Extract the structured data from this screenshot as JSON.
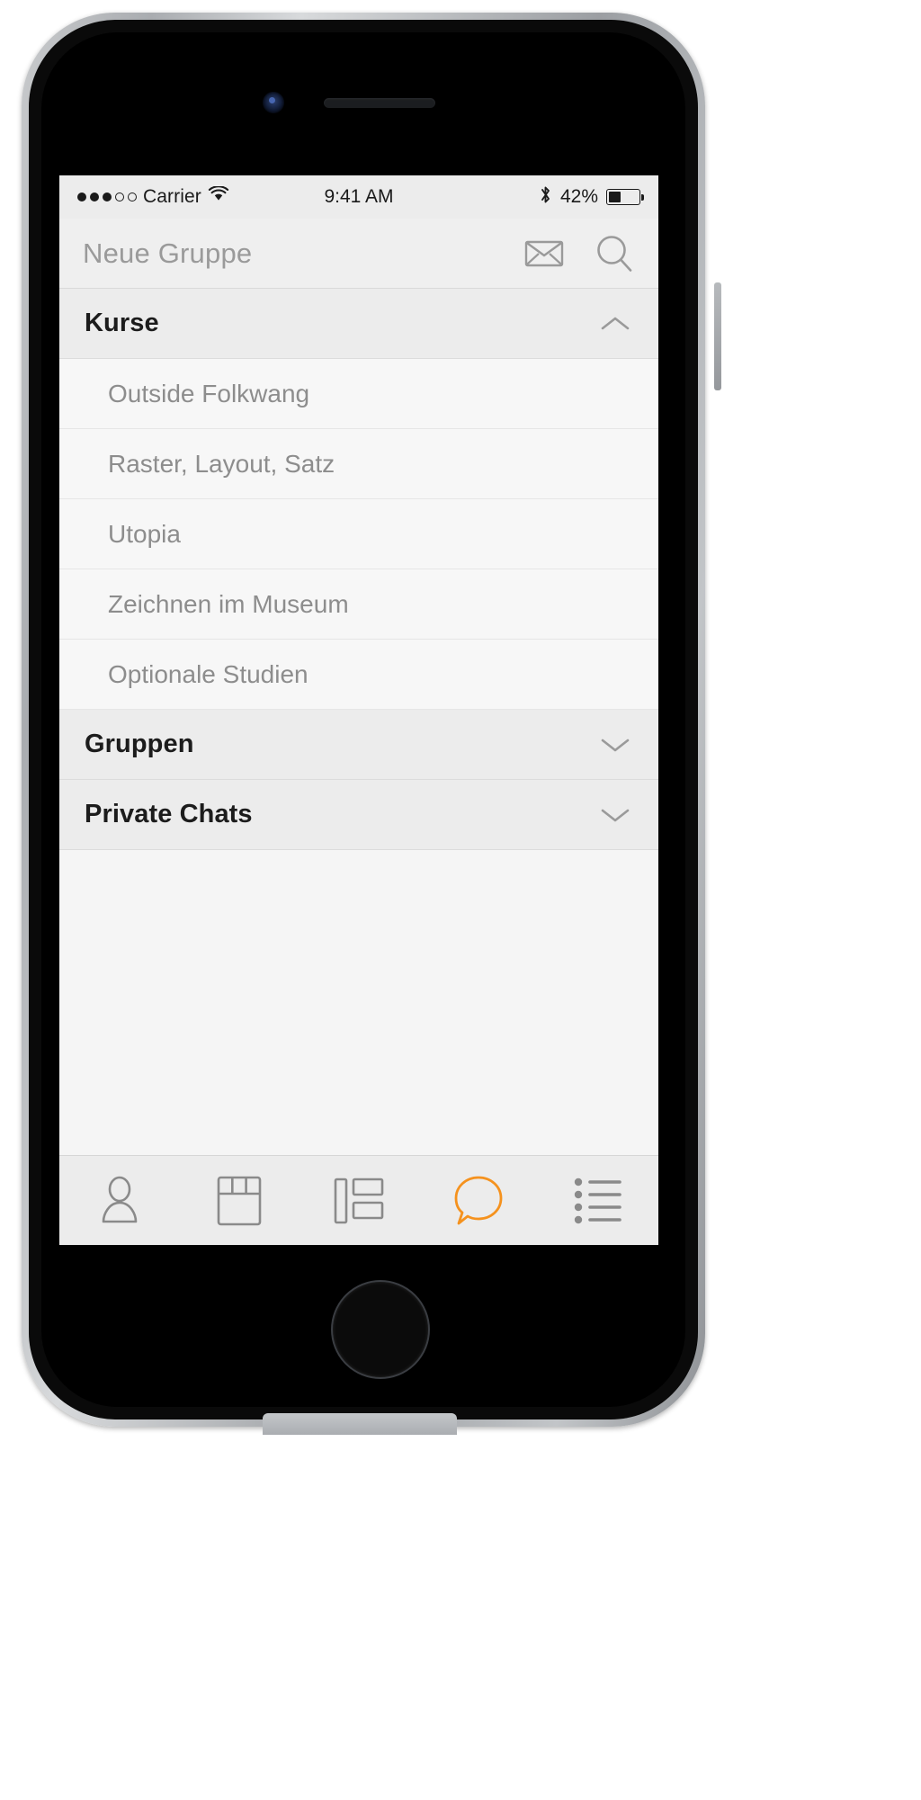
{
  "device": {
    "name": "iphone-mockup",
    "frame_color": "#b1b4b8"
  },
  "status_bar": {
    "signal_dots_filled": 3,
    "signal_dots_total": 5,
    "carrier": "Carrier",
    "wifi_icon": "wifi-icon",
    "time": "9:41 AM",
    "bluetooth_icon": "bluetooth-icon",
    "battery_percent_label": "42%",
    "battery_level": 42
  },
  "navbar": {
    "title": "Neue Gruppe",
    "actions": [
      {
        "icon": "envelope-icon",
        "name": "compose-message-button"
      },
      {
        "icon": "search-icon",
        "name": "search-button"
      }
    ]
  },
  "sections": [
    {
      "id": "kurse",
      "label": "Kurse",
      "expanded": true,
      "chevron": "chevron-up-icon",
      "items": [
        {
          "label": "Outside Folkwang"
        },
        {
          "label": "Raster, Layout, Satz"
        },
        {
          "label": "Utopia"
        },
        {
          "label": "Zeichnen im Museum"
        },
        {
          "label": "Optionale Studien"
        }
      ]
    },
    {
      "id": "gruppen",
      "label": "Gruppen",
      "expanded": false,
      "chevron": "chevron-down-icon",
      "items": []
    },
    {
      "id": "private-chats",
      "label": "Private Chats",
      "expanded": false,
      "chevron": "chevron-down-icon",
      "items": []
    }
  ],
  "tabbar": {
    "active_index": 3,
    "active_color": "#f5921e",
    "inactive_color": "#8a8a8a",
    "tabs": [
      {
        "icon": "person-icon",
        "name": "tab-profile"
      },
      {
        "icon": "calendar-icon",
        "name": "tab-calendar"
      },
      {
        "icon": "layout-icon",
        "name": "tab-board"
      },
      {
        "icon": "chat-bubble-icon",
        "name": "tab-chats"
      },
      {
        "icon": "list-icon",
        "name": "tab-list"
      }
    ]
  },
  "colors": {
    "screen_bg": "#f7f7f7",
    "header_bg": "#efefef",
    "section_bg": "#ececec",
    "row_text": "#8d8d8d",
    "heading_text": "#1c1c1c",
    "accent": "#f5921e"
  }
}
